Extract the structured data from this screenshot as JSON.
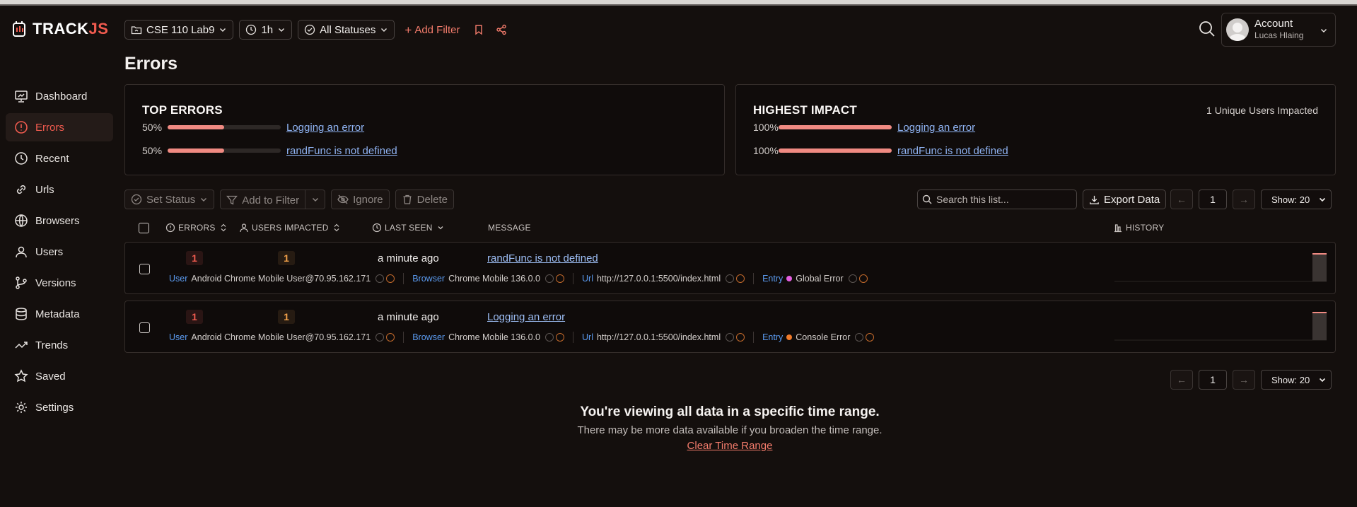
{
  "brand": {
    "prefix": "TRACK",
    "suffix": "JS"
  },
  "toolbar": {
    "app_selector": "CSE 110 Lab9",
    "time_range": "1h",
    "status_filter": "All Statuses",
    "add_filter": "Add Filter"
  },
  "account": {
    "title": "Account",
    "user": "Lucas Hlaing"
  },
  "sidebar": {
    "items": [
      {
        "label": "Dashboard",
        "icon": "presentation-icon"
      },
      {
        "label": "Errors",
        "icon": "alert-circle-icon",
        "active": true
      },
      {
        "label": "Recent",
        "icon": "clock-icon"
      },
      {
        "label": "Urls",
        "icon": "link-icon"
      },
      {
        "label": "Browsers",
        "icon": "globe-icon"
      },
      {
        "label": "Users",
        "icon": "user-icon"
      },
      {
        "label": "Versions",
        "icon": "git-branch-icon"
      },
      {
        "label": "Metadata",
        "icon": "database-icon"
      },
      {
        "label": "Trends",
        "icon": "trend-line-icon"
      },
      {
        "label": "Saved",
        "icon": "star-icon"
      },
      {
        "label": "Settings",
        "icon": "gear-icon"
      }
    ]
  },
  "page": {
    "title": "Errors"
  },
  "top_errors": {
    "title": "TOP ERRORS",
    "rows": [
      {
        "pct": "50%",
        "fraction": 0.5,
        "message": "Logging an error"
      },
      {
        "pct": "50%",
        "fraction": 0.5,
        "message": "randFunc is not defined"
      }
    ]
  },
  "highest_impact": {
    "title": "HIGHEST IMPACT",
    "summary": "1 Unique Users Impacted",
    "rows": [
      {
        "pct": "100%",
        "fraction": 1.0,
        "message": "Logging an error"
      },
      {
        "pct": "100%",
        "fraction": 1.0,
        "message": "randFunc is not defined"
      }
    ]
  },
  "actions": {
    "set_status": "Set Status",
    "add_to_filter": "Add to Filter",
    "ignore": "Ignore",
    "delete": "Delete",
    "search_placeholder": "Search this list...",
    "export": "Export Data",
    "page": "1",
    "show": "Show: 20"
  },
  "table": {
    "headers": {
      "errors": "ERRORS",
      "users": "USERS IMPACTED",
      "last_seen": "LAST SEEN",
      "message": "MESSAGE",
      "history": "HISTORY"
    },
    "rows": [
      {
        "errors": "1",
        "users": "1",
        "last_seen": "a minute ago",
        "message": "randFunc is not defined",
        "user_key": "User",
        "user_val": "Android Chrome Mobile User@70.95.162.171",
        "browser_key": "Browser",
        "browser_val": "Chrome Mobile 136.0.0",
        "url_key": "Url",
        "url_val": "http://127.0.0.1:5500/index.html",
        "entry_key": "Entry",
        "entry_val": "Global Error",
        "entry_color": "#e35fe0"
      },
      {
        "errors": "1",
        "users": "1",
        "last_seen": "a minute ago",
        "message": "Logging an error",
        "user_key": "User",
        "user_val": "Android Chrome Mobile User@70.95.162.171",
        "browser_key": "Browser",
        "browser_val": "Chrome Mobile 136.0.0",
        "url_key": "Url",
        "url_val": "http://127.0.0.1:5500/index.html",
        "entry_key": "Entry",
        "entry_val": "Console Error",
        "entry_color": "#f07a2a"
      }
    ]
  },
  "pagination_bottom": {
    "page": "1",
    "show": "Show: 20"
  },
  "notice": {
    "title": "You're viewing all data in a specific time range.",
    "subtitle": "There may be more data available if you broaden the time range.",
    "link": "Clear Time Range"
  }
}
